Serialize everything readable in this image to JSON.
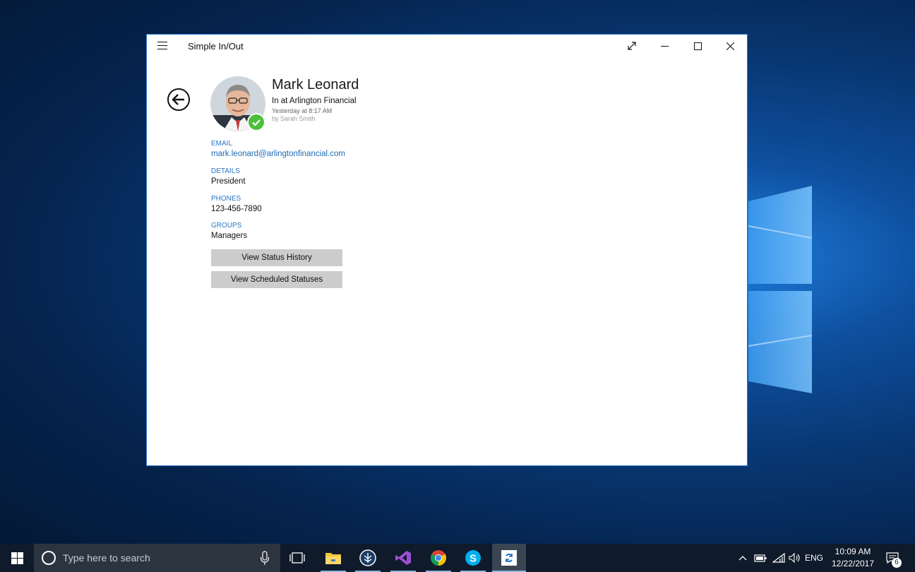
{
  "window": {
    "title": "Simple In/Out"
  },
  "contact": {
    "name": "Mark Leonard",
    "status": "In at Arlington Financial",
    "status_time": "Yesterday at 8:17 AM",
    "status_by": "by Sarah Smith",
    "status_color": "#4cc03a"
  },
  "fields": [
    {
      "label": "EMAIL",
      "value": "mark.leonard@arlingtonfinancial.com"
    },
    {
      "label": "DETAILS",
      "value": "President"
    },
    {
      "label": "PHONES",
      "value": "123-456-7890"
    },
    {
      "label": "GROUPS",
      "value": "Managers"
    }
  ],
  "buttons": {
    "history": "View Status History",
    "scheduled": "View Scheduled Statuses"
  },
  "taskbar": {
    "search_placeholder": "Type here to search",
    "pinned": [
      "task-view-icon",
      "file-explorer-icon",
      "app-icon",
      "visual-studio-icon",
      "chrome-icon",
      "skype-icon",
      "simple-in-out-icon"
    ],
    "language": "ENG",
    "time": "10:09 AM",
    "date": "12/22/2017",
    "notification_count": "6"
  },
  "colors": {
    "accent": "#2a78c4",
    "taskbar": "#0f1a2a"
  }
}
